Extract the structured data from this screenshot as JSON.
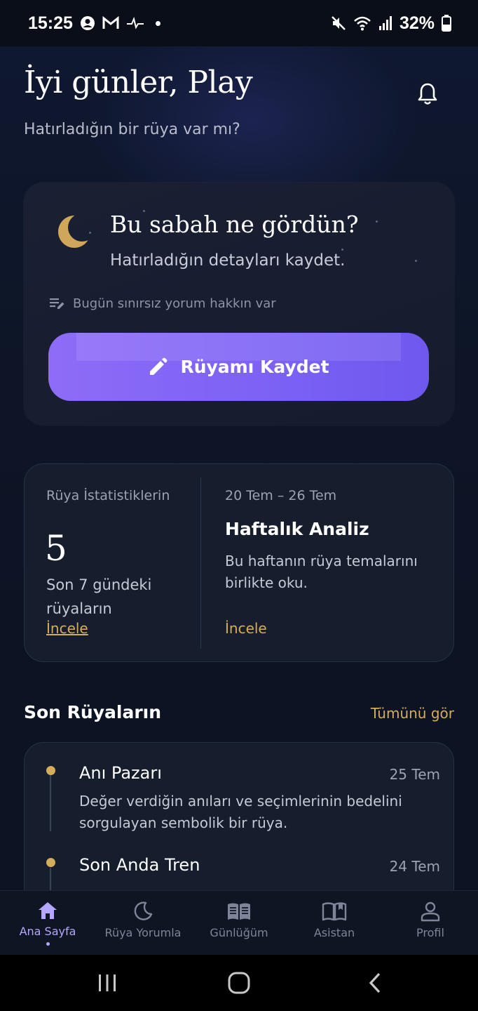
{
  "status_bar": {
    "time": "15:25",
    "battery": "32%"
  },
  "header": {
    "greeting": "İyi günler, Play",
    "subtitle": "Hatırladığın bir rüya var mı?"
  },
  "dream_card": {
    "title": "Bu sabah ne gördün?",
    "subtitle": "Hatırladığın detayları kaydet.",
    "quota_text": "Bugün sınırsız yorum hakkın var",
    "button_label": "Rüyamı Kaydet"
  },
  "stats": {
    "label": "Rüya İstatistiklerin",
    "count": "5",
    "description": "Son 7 gündeki rüyaların",
    "link": "İncele"
  },
  "weekly": {
    "range": "20 Tem – 26 Tem",
    "title": "Haftalık Analiz",
    "description": "Bu haftanın rüya temalarını birlikte oku.",
    "link": "İncele"
  },
  "recent": {
    "heading": "Son Rüyaların",
    "see_all": "Tümünü gör",
    "items": [
      {
        "title": "Anı Pazarı",
        "date": "25 Tem",
        "description": "Değer verdiğin anıları ve seçimlerinin bedelini sorgulayan sembolik bir rüya."
      },
      {
        "title": "Son Anda Tren",
        "date": "24 Tem",
        "description": ""
      }
    ]
  },
  "bottom_nav": {
    "items": [
      {
        "label": "Ana Sayfa",
        "icon": "home-icon",
        "active": true
      },
      {
        "label": "Rüya Yorumla",
        "icon": "moon-icon",
        "active": false
      },
      {
        "label": "Günlüğüm",
        "icon": "book-icon",
        "active": false
      },
      {
        "label": "Asistan",
        "icon": "open-book-icon",
        "active": false
      },
      {
        "label": "Profil",
        "icon": "person-icon",
        "active": false
      }
    ]
  },
  "colors": {
    "accent_purple": "#7d62f5",
    "gold": "#d4ad5b",
    "background": "#0d1424"
  }
}
